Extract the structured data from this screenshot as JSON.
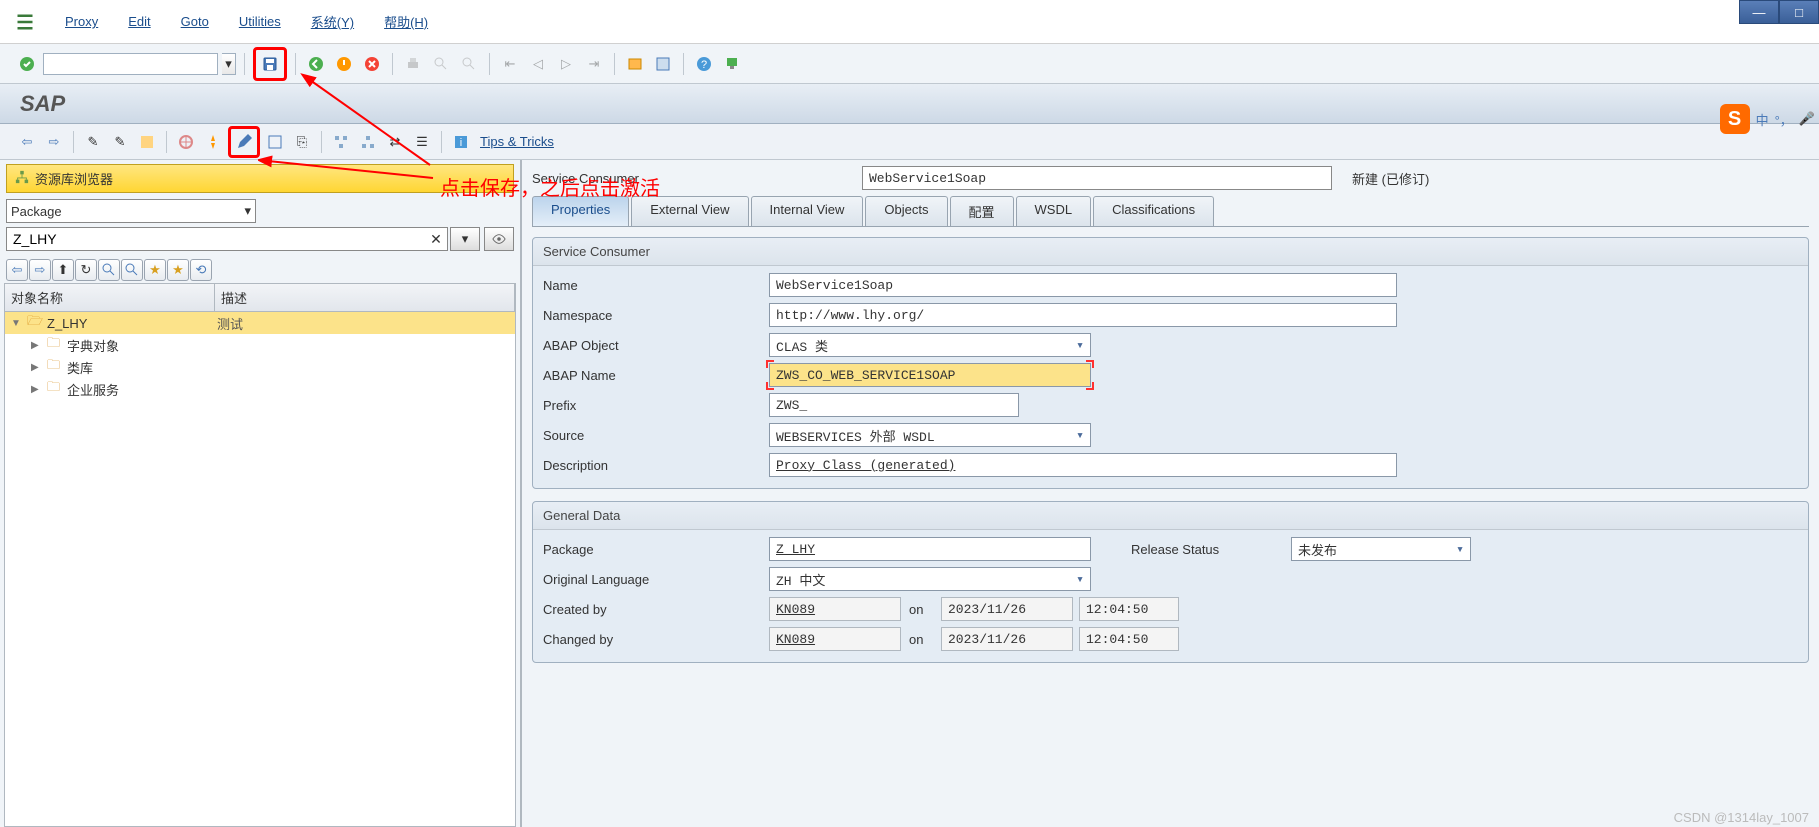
{
  "menu": {
    "items": [
      "Proxy",
      "Edit",
      "Goto",
      "Utilities",
      "系统(Y)",
      "帮助(H)"
    ]
  },
  "sap_title": "SAP",
  "tips_tricks": "Tips & Tricks",
  "left": {
    "browser_title": "资源库浏览器",
    "scope": "Package",
    "package_value": "Z_LHY",
    "columns": {
      "name": "对象名称",
      "desc": "描述"
    },
    "tree": [
      {
        "label": "Z_LHY",
        "desc": "测试",
        "level": 0,
        "expanded": true,
        "selected": true
      },
      {
        "label": "字典对象",
        "desc": "",
        "level": 1,
        "expanded": false
      },
      {
        "label": "类库",
        "desc": "",
        "level": 1,
        "expanded": false
      },
      {
        "label": "企业服务",
        "desc": "",
        "level": 1,
        "expanded": false
      }
    ]
  },
  "right": {
    "header_label": "Service Consumer",
    "header_value": "WebService1Soap",
    "status": "新建 (已修订)",
    "tabs": [
      "Properties",
      "External View",
      "Internal View",
      "Objects",
      "配置",
      "WSDL",
      "Classifications"
    ],
    "active_tab": 0,
    "panel1": {
      "title": "Service Consumer",
      "name_label": "Name",
      "name_value": "WebService1Soap",
      "namespace_label": "Namespace",
      "namespace_value": "http://www.lhy.org/",
      "abap_obj_label": "ABAP Object",
      "abap_obj_value": "CLAS 类",
      "abap_name_label": "ABAP Name",
      "abap_name_value": "ZWS_CO_WEB_SERVICE1SOAP",
      "prefix_label": "Prefix",
      "prefix_value": "ZWS_",
      "source_label": "Source",
      "source_value": "WEBSERVICES 外部 WSDL",
      "desc_label": "Description",
      "desc_value": "Proxy Class (generated)"
    },
    "panel2": {
      "title": "General Data",
      "package_label": "Package",
      "package_value": "Z_LHY",
      "release_label": "Release Status",
      "release_value": "未发布",
      "lang_label": "Original Language",
      "lang_value": "ZH 中文",
      "created_label": "Created by",
      "created_by": "KN089",
      "created_on": "on",
      "created_date": "2023/11/26",
      "created_time": "12:04:50",
      "changed_label": "Changed by",
      "changed_by": "KN089",
      "changed_on": "on",
      "changed_date": "2023/11/26",
      "changed_time": "12:04:50"
    }
  },
  "annotation": "点击保存，之后点击激活",
  "ime": {
    "lang": "中"
  },
  "watermark": "CSDN @1314lay_1007"
}
